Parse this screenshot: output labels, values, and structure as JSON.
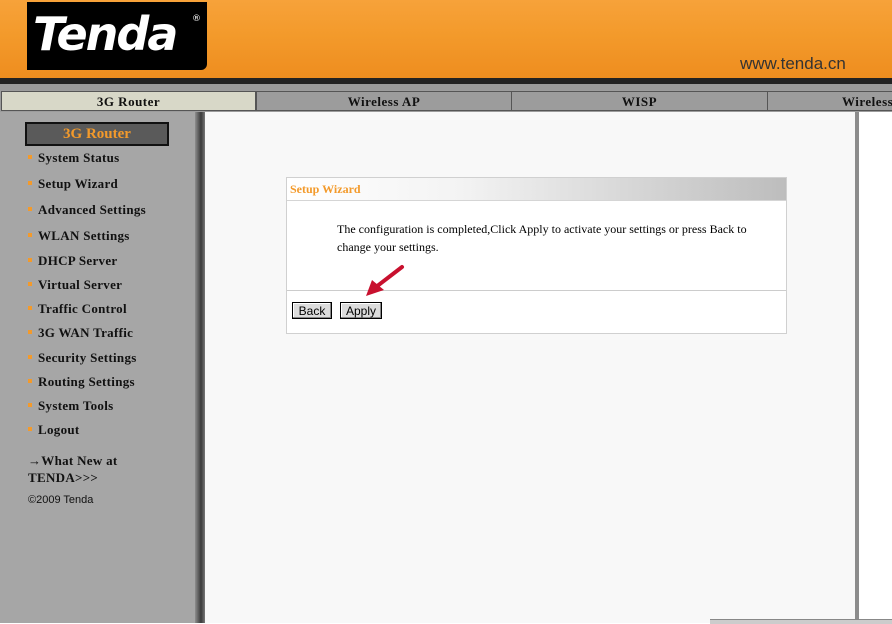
{
  "header": {
    "logo_text": "Tenda",
    "logo_mark": "®",
    "site_url": "www.tenda.cn"
  },
  "tabs": [
    {
      "label": "3G Router",
      "active": true
    },
    {
      "label": "Wireless AP",
      "active": false
    },
    {
      "label": "WISP",
      "active": false
    },
    {
      "label": "Wireless",
      "active": false
    }
  ],
  "sidebar": {
    "title": "3G Router",
    "items": [
      {
        "label": "System Status"
      },
      {
        "label": "Setup Wizard"
      },
      {
        "label": "Advanced Settings"
      },
      {
        "label": "WLAN Settings"
      },
      {
        "label": "DHCP Server"
      },
      {
        "label": "Virtual Server"
      },
      {
        "label": "Traffic Control"
      },
      {
        "label": "3G WAN Traffic"
      },
      {
        "label": "Security Settings"
      },
      {
        "label": "Routing Settings"
      },
      {
        "label": "System Tools"
      },
      {
        "label": "Logout"
      }
    ],
    "whats_new": "→What New at TENDA>>>",
    "copyright": "©2009 Tenda"
  },
  "wizard": {
    "title": "Setup Wizard",
    "message": "The configuration is completed,Click Apply to activate your settings or press Back to change your settings.",
    "back_label": "Back",
    "apply_label": "Apply"
  },
  "colors": {
    "brand_orange": "#f39a2b",
    "arrow_red": "#c8102e"
  }
}
